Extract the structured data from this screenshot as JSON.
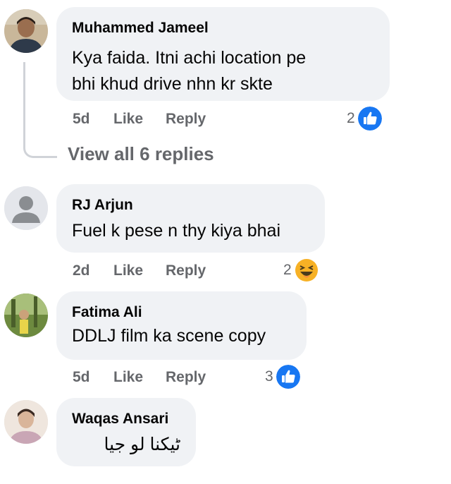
{
  "comments": [
    {
      "author": "Muhammed Jameel",
      "lines": [
        "Kya faida. Itni achi location pe",
        "bhi khud drive nhn kr skte"
      ],
      "time": "5d",
      "like_label": "Like",
      "reply_label": "Reply",
      "reaction_count": "2",
      "reaction_icon": "like-icon"
    },
    {
      "author": "RJ Arjun",
      "lines": [
        "Fuel k pese n thy kiya bhai"
      ],
      "time": "2d",
      "like_label": "Like",
      "reply_label": "Reply",
      "reaction_count": "2",
      "reaction_icon": "haha-icon"
    },
    {
      "author": "Fatima Ali",
      "lines": [
        "DDLJ film ka scene copy"
      ],
      "time": "5d",
      "like_label": "Like",
      "reply_label": "Reply",
      "reaction_count": "3",
      "reaction_icon": "like-icon"
    },
    {
      "author": "Waqas Ansari",
      "lines": [
        "ٹیکنا لو جیا"
      ]
    }
  ],
  "view_replies_label": "View all 6 replies",
  "colors": {
    "bubble": "#f0f2f5",
    "meta_text": "#65676b",
    "like_blue": "#1877f2",
    "haha_yellow": "#f7b125"
  }
}
